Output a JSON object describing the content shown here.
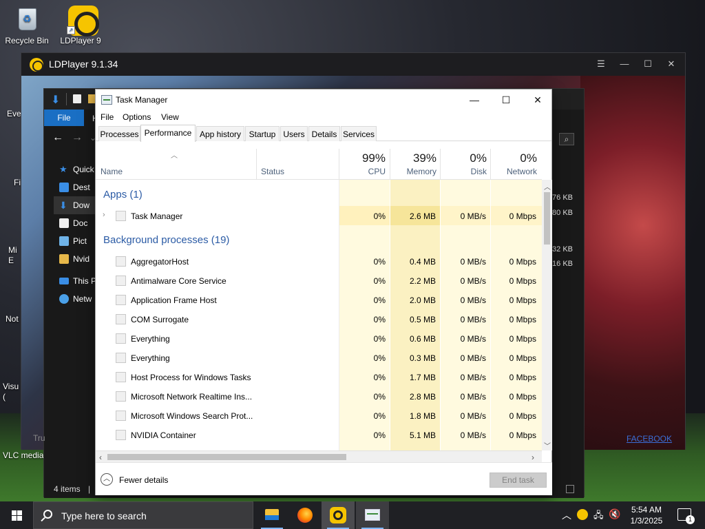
{
  "desktop": {
    "icons": [
      {
        "label": "Recycle Bin"
      },
      {
        "label": "LDPlayer 9"
      },
      {
        "label": "VLC media player"
      }
    ],
    "side_labels": [
      "Eve",
      "Fi",
      "Mi\nE",
      "Not",
      "Visu\n("
    ]
  },
  "ldplayer": {
    "title": "LDPlayer 9.1.34",
    "link": "FACEBOOK"
  },
  "explorer": {
    "file_tab": "File",
    "ribbon_letter": "H",
    "sidebar": [
      "Quick",
      "Dest",
      "Dow",
      "Doc",
      "Pict",
      "Nvid",
      "This P",
      "Netw"
    ],
    "sizes": [
      "76 KB",
      "80 KB",
      "32 KB",
      "16 KB"
    ],
    "status": "4 items",
    "status_sep": "|",
    "search_hint": "Tru"
  },
  "taskmanager": {
    "title": "Task Manager",
    "menu": [
      "File",
      "Options",
      "View"
    ],
    "tabs": [
      "Processes",
      "Performance",
      "App history",
      "Startup",
      "Users",
      "Details",
      "Services"
    ],
    "active_tab": "Performance",
    "columns": {
      "name": "Name",
      "status": "Status",
      "cpu": {
        "pct": "99%",
        "label": "CPU"
      },
      "memory": {
        "pct": "39%",
        "label": "Memory"
      },
      "disk": {
        "pct": "0%",
        "label": "Disk"
      },
      "network": {
        "pct": "0%",
        "label": "Network"
      }
    },
    "apps_group": "Apps (1)",
    "apps": [
      {
        "name": "Task Manager",
        "cpu": "0%",
        "mem": "2.6 MB",
        "disk": "0 MB/s",
        "net": "0 Mbps"
      }
    ],
    "bg_group": "Background processes (19)",
    "background": [
      {
        "name": "AggregatorHost",
        "cpu": "0%",
        "mem": "0.4 MB",
        "disk": "0 MB/s",
        "net": "0 Mbps"
      },
      {
        "name": "Antimalware Core Service",
        "cpu": "0%",
        "mem": "2.2 MB",
        "disk": "0 MB/s",
        "net": "0 Mbps"
      },
      {
        "name": "Application Frame Host",
        "cpu": "0%",
        "mem": "2.0 MB",
        "disk": "0 MB/s",
        "net": "0 Mbps"
      },
      {
        "name": "COM Surrogate",
        "cpu": "0%",
        "mem": "0.5 MB",
        "disk": "0 MB/s",
        "net": "0 Mbps"
      },
      {
        "name": "Everything",
        "cpu": "0%",
        "mem": "0.6 MB",
        "disk": "0 MB/s",
        "net": "0 Mbps"
      },
      {
        "name": "Everything",
        "cpu": "0%",
        "mem": "0.3 MB",
        "disk": "0 MB/s",
        "net": "0 Mbps"
      },
      {
        "name": "Host Process for Windows Tasks",
        "cpu": "0%",
        "mem": "1.7 MB",
        "disk": "0 MB/s",
        "net": "0 Mbps"
      },
      {
        "name": "Microsoft Network Realtime Ins...",
        "cpu": "0%",
        "mem": "2.8 MB",
        "disk": "0 MB/s",
        "net": "0 Mbps"
      },
      {
        "name": "Microsoft Windows Search Prot...",
        "cpu": "0%",
        "mem": "1.8 MB",
        "disk": "0 MB/s",
        "net": "0 Mbps"
      },
      {
        "name": "NVIDIA Container",
        "cpu": "0%",
        "mem": "5.1 MB",
        "disk": "0 MB/s",
        "net": "0 Mbps"
      }
    ],
    "fewer_details": "Fewer details",
    "end_task": "End task"
  },
  "taskbar": {
    "search_placeholder": "Type here to search",
    "time": "5:54 AM",
    "date": "1/3/2025",
    "notification_count": "1"
  },
  "colors": {
    "cpu_heat": "#fff4c4",
    "mem_heat": "#f9eca8",
    "heat_light": "#fffadf",
    "group_blue": "#2b5ba5",
    "accent": "#1a6fc4"
  }
}
